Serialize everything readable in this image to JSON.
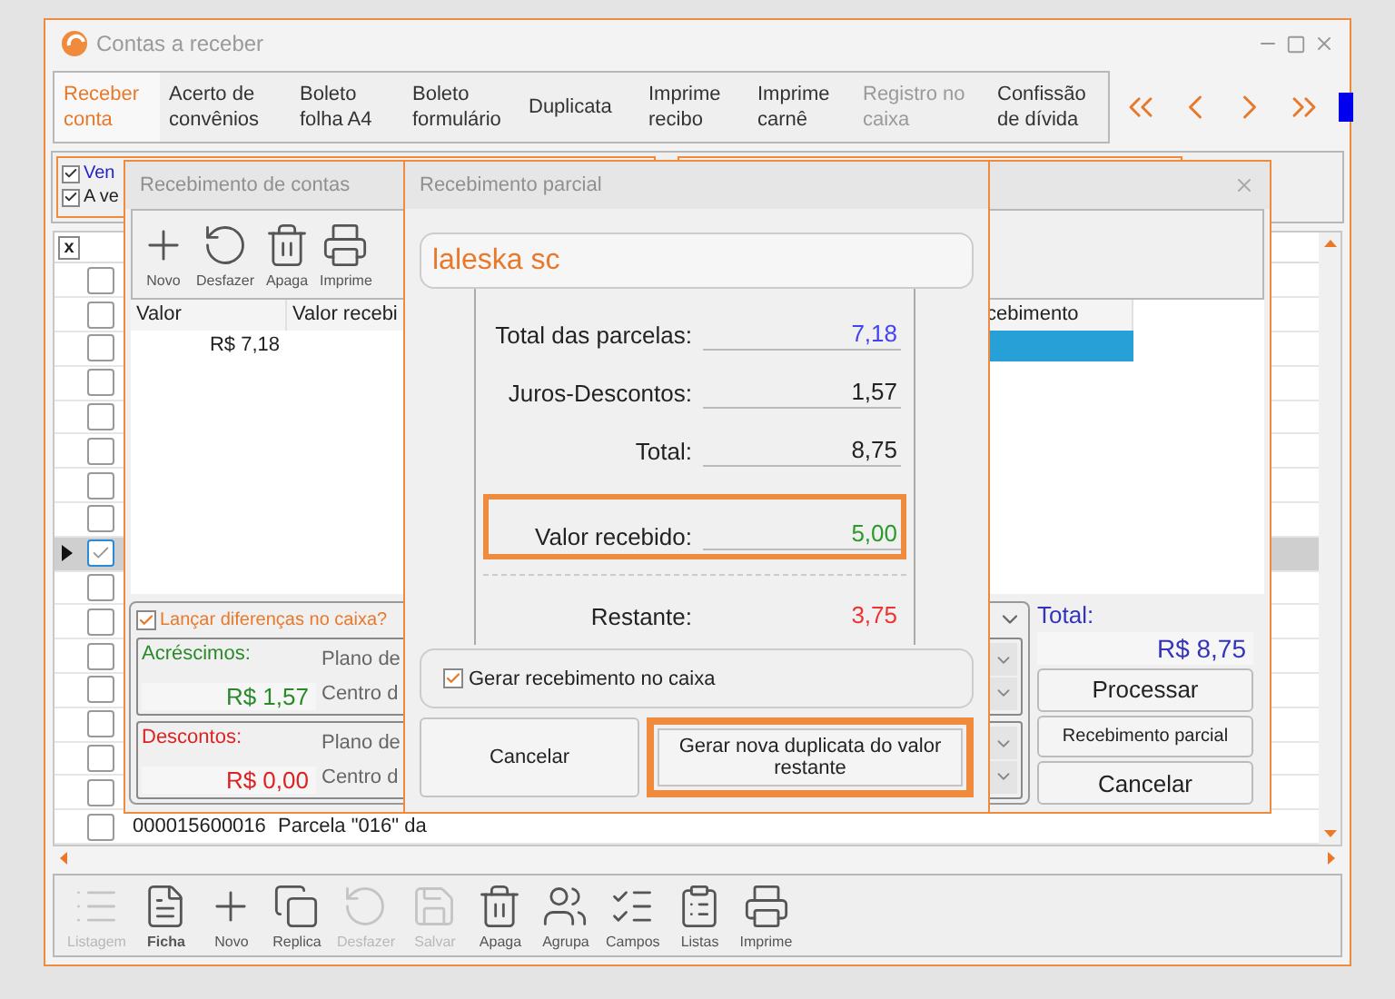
{
  "window": {
    "title": "Contas a receber"
  },
  "tabs": [
    {
      "label": "Receber conta",
      "selected": true,
      "disabled": false
    },
    {
      "label": "Acerto de convênios",
      "selected": false,
      "disabled": false
    },
    {
      "label": "Boleto folha A4",
      "selected": false,
      "disabled": false
    },
    {
      "label": "Boleto formulário",
      "selected": false,
      "disabled": false
    },
    {
      "label": "Duplicata",
      "selected": false,
      "disabled": false
    },
    {
      "label": "Imprime recibo",
      "selected": false,
      "disabled": false
    },
    {
      "label": "Imprime carnê",
      "selected": false,
      "disabled": false
    },
    {
      "label": "Registro no caixa",
      "selected": false,
      "disabled": true
    },
    {
      "label": "Confissão de dívida",
      "selected": false,
      "disabled": false
    }
  ],
  "filters": [
    {
      "label": "Ven",
      "checked": true,
      "color": "#2222cc"
    },
    {
      "label": "A ve",
      "checked": true,
      "color": "#222222"
    }
  ],
  "grid": {
    "header": "x",
    "rows": [
      {
        "checked": false,
        "current": false
      },
      {
        "checked": false,
        "current": false
      },
      {
        "checked": false,
        "current": false
      },
      {
        "checked": false,
        "current": false
      },
      {
        "checked": false,
        "current": false
      },
      {
        "checked": false,
        "current": false
      },
      {
        "checked": false,
        "current": false
      },
      {
        "checked": false,
        "current": false
      },
      {
        "checked": true,
        "current": true
      },
      {
        "checked": false,
        "current": false
      },
      {
        "checked": false,
        "current": false
      },
      {
        "checked": false,
        "current": false
      },
      {
        "checked": false,
        "current": false
      },
      {
        "checked": false,
        "current": false
      },
      {
        "checked": false,
        "current": false
      },
      {
        "checked": false,
        "current": false
      },
      {
        "checked": false,
        "current": false,
        "code": "000015600016",
        "description": "Parcela \"016\" da"
      }
    ]
  },
  "toolbar": [
    {
      "label": "Listagem",
      "kind": "list",
      "disabled": true,
      "selected": false
    },
    {
      "label": "Ficha",
      "kind": "form",
      "disabled": false,
      "selected": true
    },
    {
      "label": "Novo",
      "kind": "plus",
      "disabled": false,
      "selected": false
    },
    {
      "label": "Replica",
      "kind": "copy",
      "disabled": false,
      "selected": false
    },
    {
      "label": "Desfazer",
      "kind": "undo",
      "disabled": true,
      "selected": false
    },
    {
      "label": "Salvar",
      "kind": "save",
      "disabled": true,
      "selected": false
    },
    {
      "label": "Apaga",
      "kind": "trash",
      "disabled": false,
      "selected": false
    },
    {
      "label": "Agrupa",
      "kind": "group",
      "disabled": false,
      "selected": false
    },
    {
      "label": "Campos",
      "kind": "fields",
      "disabled": false,
      "selected": false
    },
    {
      "label": "Listas",
      "kind": "lists",
      "disabled": false,
      "selected": false
    },
    {
      "label": "Imprime",
      "kind": "print",
      "disabled": false,
      "selected": false
    }
  ],
  "receipt_dialog": {
    "title": "Recebimento de contas",
    "toolbar": [
      {
        "label": "Novo",
        "kind": "plus"
      },
      {
        "label": "Desfazer",
        "kind": "undo"
      },
      {
        "label": "Apaga",
        "kind": "trash"
      },
      {
        "label": "Imprime",
        "kind": "print"
      }
    ],
    "columns": [
      "Valor",
      "Valor recebi",
      "cebimento"
    ],
    "rows": [
      {
        "column_1": "R$ 7,18",
        "selected": true
      }
    ],
    "differences": {
      "label": "Lançar diferenças no caixa?",
      "checked": true
    },
    "adjustments": [
      {
        "label": "Acréscimos:",
        "amount": "R$ 1,57",
        "color": "#2a8a2a",
        "fields": [
          "Plano de",
          "Centro d"
        ]
      },
      {
        "label": "Descontos:",
        "amount": "R$ 0,00",
        "color": "#dd2222",
        "fields": [
          "Plano de",
          "Centro d"
        ]
      }
    ],
    "total": {
      "label": "Total:",
      "value": "R$ 8,75"
    },
    "buttons": [
      "Processar",
      "Recebimento parcial",
      "Cancelar"
    ]
  },
  "partial_dialog": {
    "title": "Recebimento parcial",
    "customer": "laleska sc",
    "lines": [
      {
        "label": "Total das parcelas:",
        "value": "7,18",
        "color": "#4444ee",
        "highlighted": false
      },
      {
        "label": "Juros-Descontos:",
        "value": "1,57",
        "color": "#222222",
        "highlighted": false
      },
      {
        "label": "Total:",
        "value": "8,75",
        "color": "#222222",
        "highlighted": false
      },
      {
        "label": "Valor recebido:",
        "value": "5,00",
        "color": "#2a9a2a",
        "highlighted": true
      }
    ],
    "remaining": {
      "label": "Restante:",
      "value": "3,75"
    },
    "cash_entry": {
      "label": "Gerar recebimento no caixa",
      "checked": true
    },
    "buttons": [
      {
        "label": "Cancelar",
        "highlighted": false
      },
      {
        "label": "Gerar nova duplicata do valor restante",
        "highlighted": true
      }
    ]
  }
}
